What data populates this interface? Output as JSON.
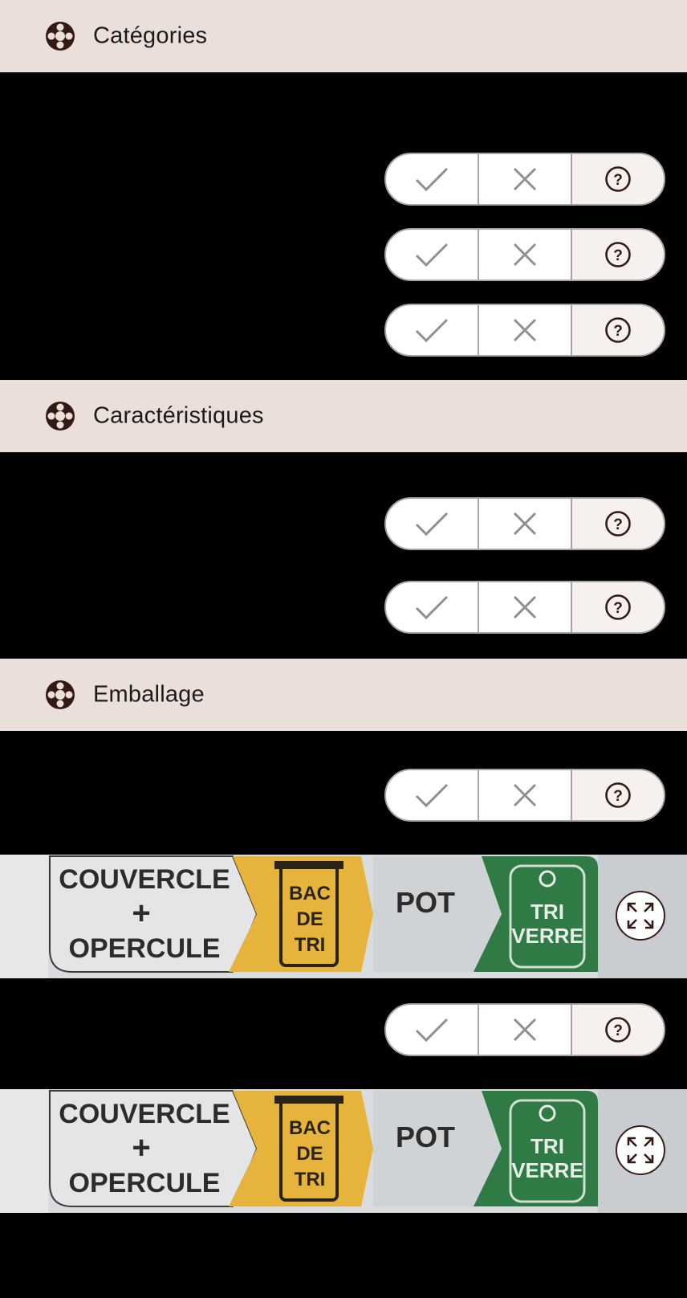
{
  "sections": {
    "categories": {
      "title": "Catégories",
      "icon": "lifebuoy-icon"
    },
    "characteristics": {
      "title": "Caractéristiques",
      "icon": "lifebuoy-icon"
    },
    "packaging": {
      "title": "Emballage",
      "icon": "lifebuoy-icon"
    }
  },
  "vote_buttons": {
    "yes_icon": "check-icon",
    "no_icon": "close-icon",
    "unknown_icon": "question-circle-icon"
  },
  "packaging_photo": {
    "panel1": [
      "COUVERCLE",
      "+",
      "OPERCULE"
    ],
    "bin": [
      "BAC",
      "DE",
      "TRI"
    ],
    "panel2": "POT",
    "glass": [
      "TRI",
      "VERRE"
    ],
    "expand_icon": "expand-icon"
  },
  "colors": {
    "header_bg": "#ebdfdc",
    "page_bg": "#000000",
    "icon_dark": "#341a12",
    "bin_yellow": "#e9b73a",
    "glass_green": "#2f7a45"
  }
}
